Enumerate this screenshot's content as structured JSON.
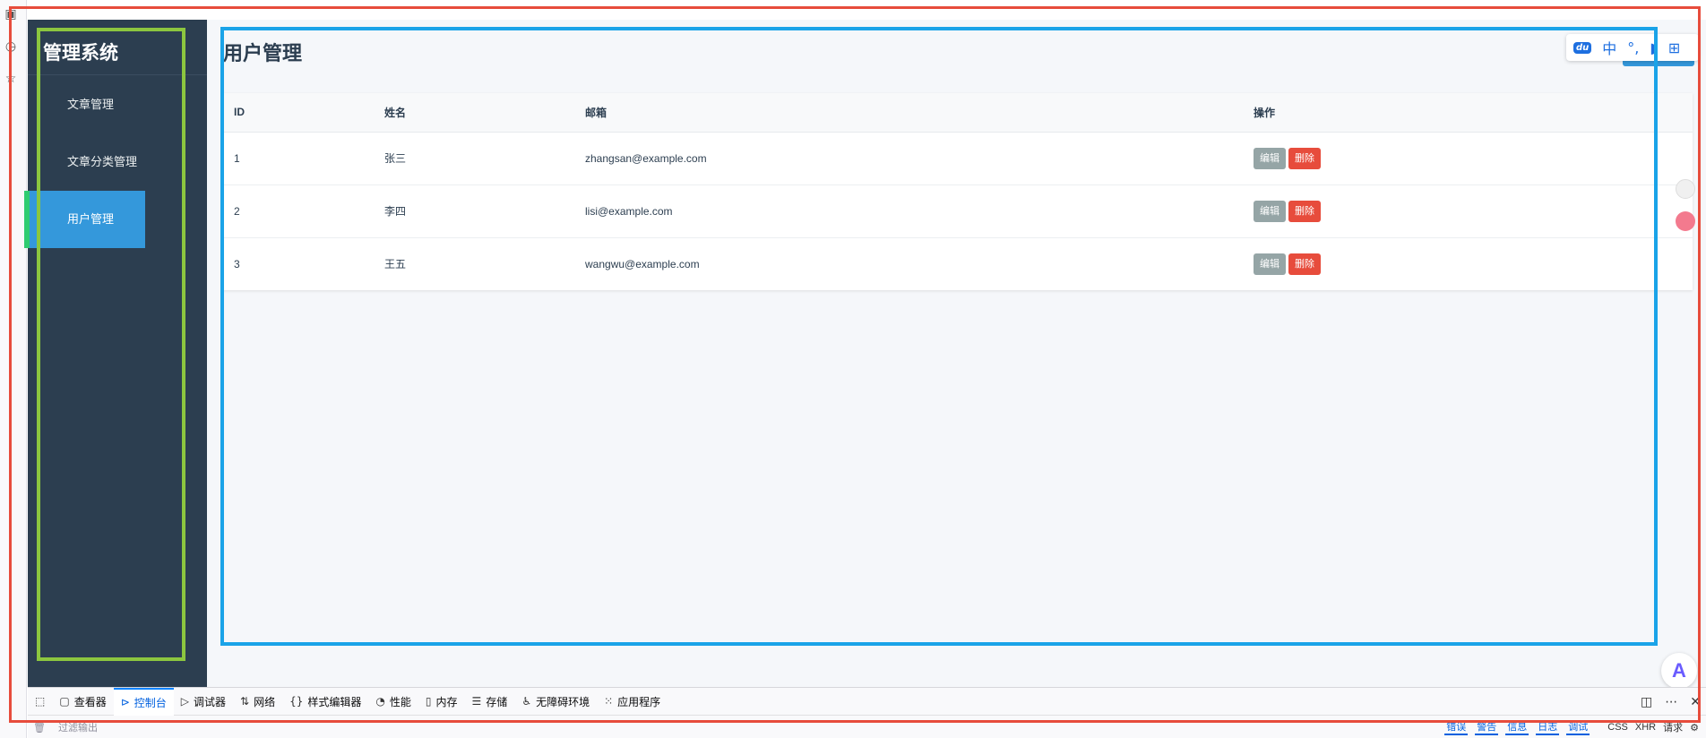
{
  "sidebar": {
    "brand": "管理系统",
    "items": [
      {
        "label": "文章管理",
        "active": false
      },
      {
        "label": "文章分类管理",
        "active": false
      },
      {
        "label": "用户管理",
        "active": true
      }
    ]
  },
  "main": {
    "title": "用户管理",
    "table": {
      "headers": [
        "ID",
        "姓名",
        "邮箱",
        "操作"
      ],
      "rows": [
        {
          "id": "1",
          "name": "张三",
          "email": "zhangsan@example.com"
        },
        {
          "id": "2",
          "name": "李四",
          "email": "lisi@example.com"
        },
        {
          "id": "3",
          "name": "王五",
          "email": "wangwu@example.com"
        }
      ],
      "edit_label": "编辑",
      "delete_label": "删除"
    }
  },
  "float_bar": {
    "logo": "du",
    "lang": "中",
    "punct": "°,"
  },
  "devtools": {
    "tabs": [
      {
        "icon": "picker-icon",
        "label": ""
      },
      {
        "icon": "inspector-icon",
        "label": "查看器"
      },
      {
        "icon": "console-icon",
        "label": "控制台",
        "active": true
      },
      {
        "icon": "debugger-icon",
        "label": "调试器"
      },
      {
        "icon": "network-icon",
        "label": "网络"
      },
      {
        "icon": "style-editor-icon",
        "label": "样式编辑器"
      },
      {
        "icon": "performance-icon",
        "label": "性能"
      },
      {
        "icon": "memory-icon",
        "label": "内存"
      },
      {
        "icon": "storage-icon",
        "label": "存储"
      },
      {
        "icon": "accessibility-icon",
        "label": "无障碍环境"
      },
      {
        "icon": "application-icon",
        "label": "应用程序"
      }
    ],
    "filter_placeholder": "过滤输出",
    "levels": [
      "错误",
      "警告",
      "信息",
      "日志",
      "调试"
    ],
    "types": [
      "CSS",
      "XHR",
      "请求"
    ]
  },
  "colors": {
    "sidebar_bg": "#2c3e50",
    "active_bg": "#3498db",
    "edit_btn": "#95a5a6",
    "delete_btn": "#e74c3c",
    "overlay_red": "#e74c3c",
    "overlay_green": "#8cc63f",
    "overlay_blue": "#1aa3e8"
  }
}
